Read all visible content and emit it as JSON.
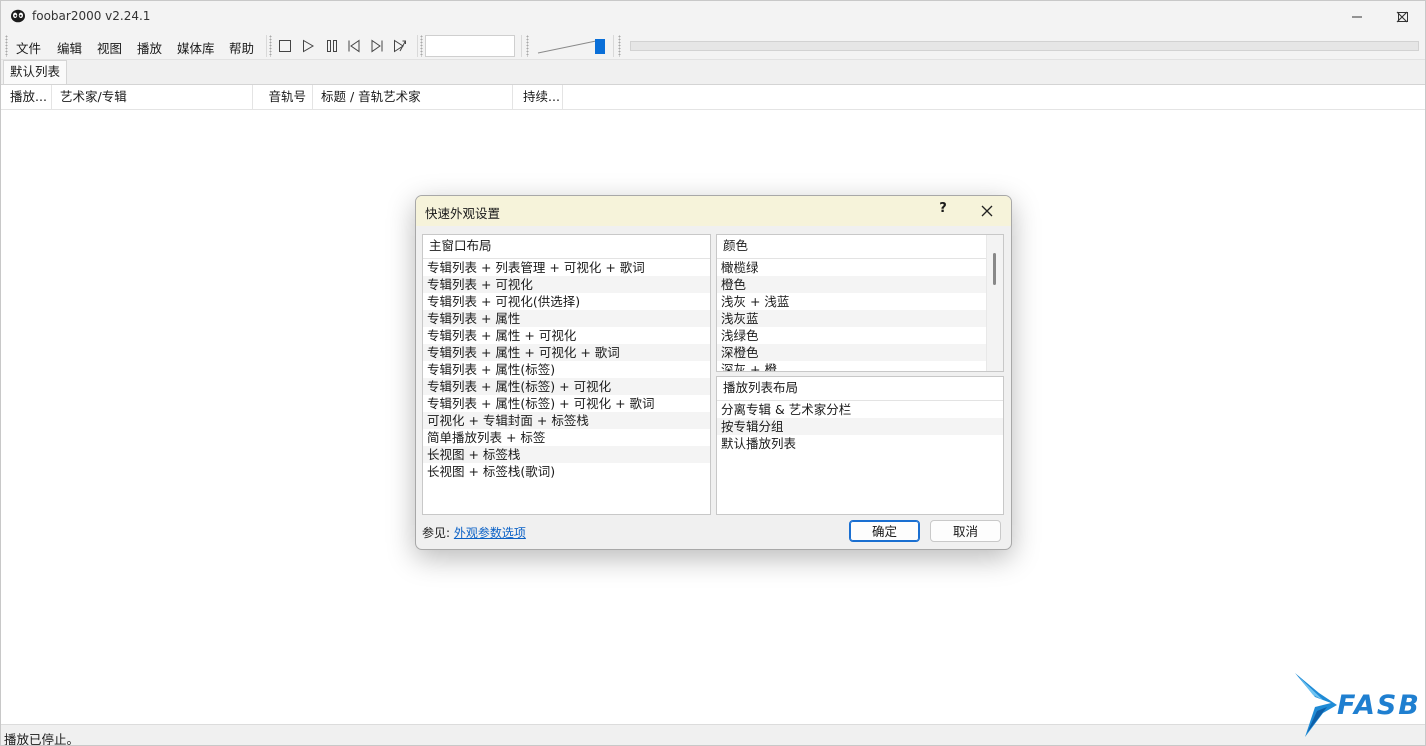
{
  "window": {
    "title": "foobar2000 v2.24.1"
  },
  "menu": [
    "文件",
    "编辑",
    "视图",
    "播放",
    "媒体库",
    "帮助"
  ],
  "playlist_tab": "默认列表",
  "columns": [
    "播放...",
    "艺术家/专辑",
    "音轨号",
    "标题 / 音轨艺术家",
    "持续..."
  ],
  "status": "播放已停止。",
  "dialog": {
    "title": "快速外观设置",
    "help": "?",
    "layout_header": "主窗口布局",
    "layouts": [
      "专辑列表 + 列表管理 + 可视化 + 歌词",
      "专辑列表 + 可视化",
      "专辑列表 + 可视化(供选择)",
      "专辑列表 + 属性",
      "专辑列表 + 属性 + 可视化",
      "专辑列表 + 属性 + 可视化 + 歌词",
      "专辑列表 + 属性(标签)",
      "专辑列表 + 属性(标签) + 可视化",
      "专辑列表 + 属性(标签) + 可视化 + 歌词",
      "可视化 + 专辑封面 + 标签栈",
      "简单播放列表 + 标签",
      "长视图 + 标签栈",
      "长视图 + 标签栈(歌词)"
    ],
    "colors_header": "颜色",
    "colors": [
      "橄榄绿",
      "橙色",
      "浅灰 + 浅蓝",
      "浅灰蓝",
      "浅绿色",
      "深橙色",
      "深灰 + 橙"
    ],
    "playlist_layout_header": "播放列表布局",
    "playlist_layouts": [
      "分离专辑 & 艺术家分栏",
      "按专辑分组",
      "默认播放列表"
    ],
    "see_also_label": "参见: ",
    "see_also_link": "外观参数选项",
    "ok": "确定",
    "cancel": "取消"
  },
  "watermark": "FASB",
  "colors_ui": {
    "accent": "#1a6fd1",
    "volume_thumb": "#0a6fd8",
    "dialog_title_bg": "#f6f3da",
    "logo_blue": "#1f8bd6"
  }
}
